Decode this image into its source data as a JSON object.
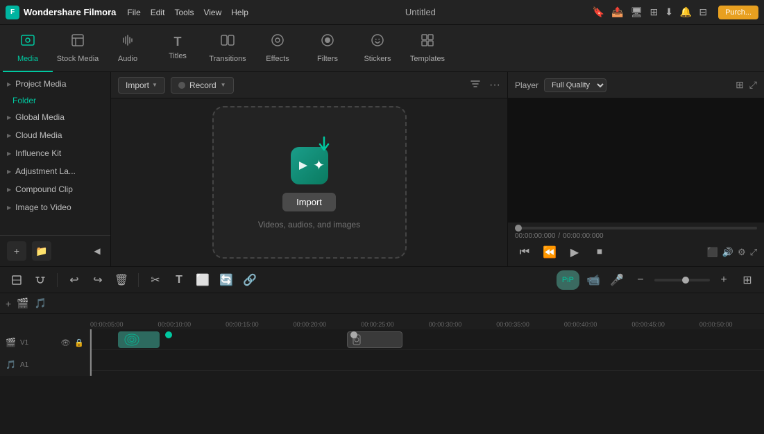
{
  "app": {
    "name": "Wondershare Filmora",
    "title": "Untitled"
  },
  "menubar": {
    "items": [
      "File",
      "Edit",
      "Tools",
      "View",
      "Help"
    ],
    "purchase_label": "Purch..."
  },
  "toolbar": {
    "items": [
      {
        "id": "media",
        "label": "Media",
        "icon": "🎬",
        "active": true
      },
      {
        "id": "stock-media",
        "label": "Stock Media",
        "icon": "📦",
        "active": false
      },
      {
        "id": "audio",
        "label": "Audio",
        "icon": "🎵",
        "active": false
      },
      {
        "id": "titles",
        "label": "Titles",
        "icon": "T",
        "active": false
      },
      {
        "id": "transitions",
        "label": "Transitions",
        "icon": "⬜",
        "active": false
      },
      {
        "id": "effects",
        "label": "Effects",
        "icon": "✦",
        "active": false
      },
      {
        "id": "filters",
        "label": "Filters",
        "icon": "◉",
        "active": false
      },
      {
        "id": "stickers",
        "label": "Stickers",
        "icon": "😊",
        "active": false
      },
      {
        "id": "templates",
        "label": "Templates",
        "icon": "⬛",
        "active": false
      }
    ]
  },
  "sidebar": {
    "sections": [
      {
        "items": [
          {
            "id": "project-media",
            "label": "Project Media",
            "active": false,
            "has_arrow": true
          },
          {
            "id": "folder",
            "label": "Folder",
            "active": true
          }
        ]
      },
      {
        "items": [
          {
            "id": "global-media",
            "label": "Global Media",
            "active": false,
            "has_arrow": true
          },
          {
            "id": "cloud-media",
            "label": "Cloud Media",
            "active": false,
            "has_arrow": true
          },
          {
            "id": "influence-kit",
            "label": "Influence Kit",
            "active": false,
            "has_arrow": true
          },
          {
            "id": "adjustment-layer",
            "label": "Adjustment La...",
            "active": false,
            "has_arrow": true
          },
          {
            "id": "compound-clip",
            "label": "Compound Clip",
            "active": false,
            "has_arrow": true
          },
          {
            "id": "image-to-video",
            "label": "Image to Video",
            "active": false,
            "has_arrow": true
          }
        ]
      }
    ],
    "bottom_buttons": [
      "+",
      "📁"
    ]
  },
  "content": {
    "import_label": "Import",
    "record_label": "Record",
    "dropzone": {
      "button_label": "Import",
      "subtitle": "Videos, audios, and images"
    }
  },
  "player": {
    "label": "Player",
    "quality": "Full Quality",
    "time_current": "00:00:00:000",
    "time_total": "00:00:00:000"
  },
  "bottom_toolbar": {
    "buttons": [
      "⊞",
      "⊡",
      "⟲",
      "⟳",
      "🗑",
      "✂",
      "T",
      "⬜",
      "🔄",
      "🔗"
    ]
  },
  "timeline": {
    "ruler_marks": [
      "00:00:05:00",
      "00:00:10:00",
      "00:00:15:00",
      "00:00:20:00",
      "00:00:25:00",
      "00:00:30:00",
      "00:00:35:00",
      "00:00:40:00",
      "00:00:45:00",
      "00:00:50:00"
    ],
    "track_labels": [
      "🎬",
      "🎵",
      "🔤"
    ],
    "controls": {
      "undo": "⟲",
      "redo": "⟳",
      "delete": "🗑",
      "cut": "✂",
      "text": "T",
      "crop": "⬜",
      "speed": "🔄",
      "link": "🔗"
    }
  }
}
